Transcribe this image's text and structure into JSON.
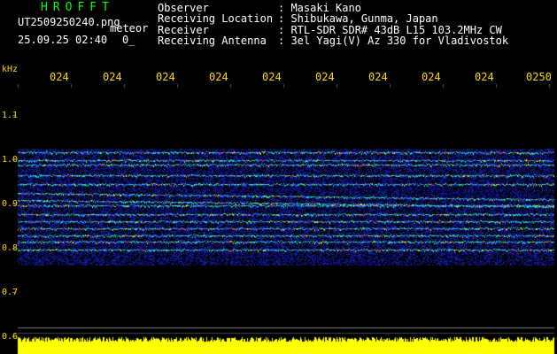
{
  "header": {
    "title": "HROFFT",
    "filename": "UT2509250240.png",
    "tag": "meteor",
    "datetime": "25.09.25 02:40",
    "flag": "0_"
  },
  "info": [
    {
      "label": "Observer",
      "value": ": Masaki Kano"
    },
    {
      "label": "Receiving Location",
      "value": ": Shibukawa, Gunma, Japan"
    },
    {
      "label": "Receiver",
      "value": ": RTL-SDR SDR# 43dB L15 103.2MHz CW"
    },
    {
      "label": "Receiving Antenna",
      "value": ": 3el Yagi(V) Az 330 for Vladivostok"
    }
  ],
  "axis": {
    "unit": "kHz",
    "y_ticks": [
      "1.1",
      "1.0",
      "0.9",
      "0.8",
      "0.7",
      "0.6"
    ],
    "x_ticks": [
      "024",
      "024",
      "024",
      "024",
      "024",
      "024",
      "024",
      "024",
      "024",
      "0250"
    ]
  },
  "colors": {
    "background": "#000000",
    "axis_text": "#ffd400",
    "title": "#00ff00",
    "noise_floor": "#0a14b4",
    "signal_strong": "#ff3020",
    "signal_mid": "#00ff80",
    "power_bar": "#ffff00"
  }
}
